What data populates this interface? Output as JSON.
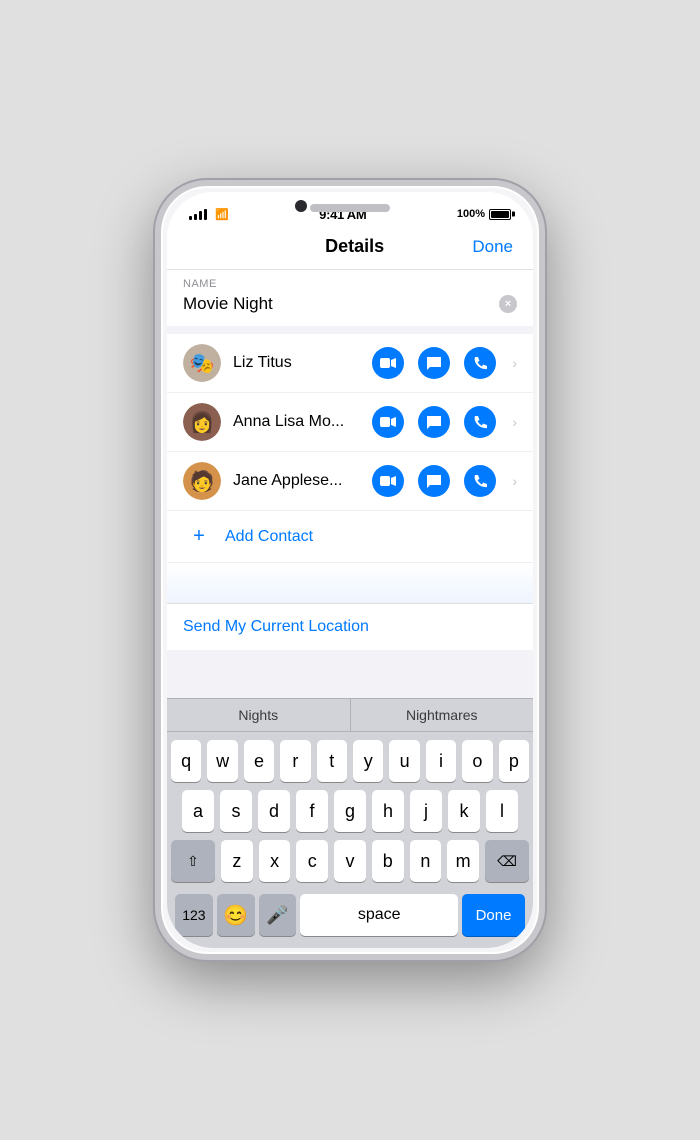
{
  "statusBar": {
    "time": "9:41 AM",
    "battery": "100%"
  },
  "navBar": {
    "title": "Details",
    "doneLabel": "Done",
    "backLabel": ""
  },
  "nameSection": {
    "label": "NAME",
    "value": "Movie Night",
    "clearButton": "×"
  },
  "contacts": [
    {
      "name": "Liz Titus",
      "avatarEmoji": "🎭",
      "avatarBg": "#c0b0a0"
    },
    {
      "name": "Anna Lisa Mo...",
      "avatarEmoji": "👩",
      "avatarBg": "#8b6050"
    },
    {
      "name": "Jane Applese...",
      "avatarEmoji": "🧑",
      "avatarBg": "#d4924a"
    }
  ],
  "addContact": {
    "label": "Add Contact",
    "plusIcon": "+"
  },
  "locationSection": {
    "label": "Send My Current Location"
  },
  "autocomplete": {
    "items": [
      "Nights",
      "Nightmares"
    ]
  },
  "keyboard": {
    "rows": [
      [
        "q",
        "w",
        "e",
        "r",
        "t",
        "y",
        "u",
        "i",
        "o",
        "p"
      ],
      [
        "a",
        "s",
        "d",
        "f",
        "g",
        "h",
        "j",
        "k",
        "l"
      ],
      [
        "z",
        "x",
        "c",
        "v",
        "b",
        "n",
        "m"
      ]
    ],
    "bottomRow": {
      "numbersLabel": "123",
      "spaceLabel": "space",
      "doneLabel": "Done"
    }
  },
  "colors": {
    "blue": "#007AFF",
    "lightGray": "#f2f2f7",
    "keyboardBg": "#d1d3d9"
  }
}
